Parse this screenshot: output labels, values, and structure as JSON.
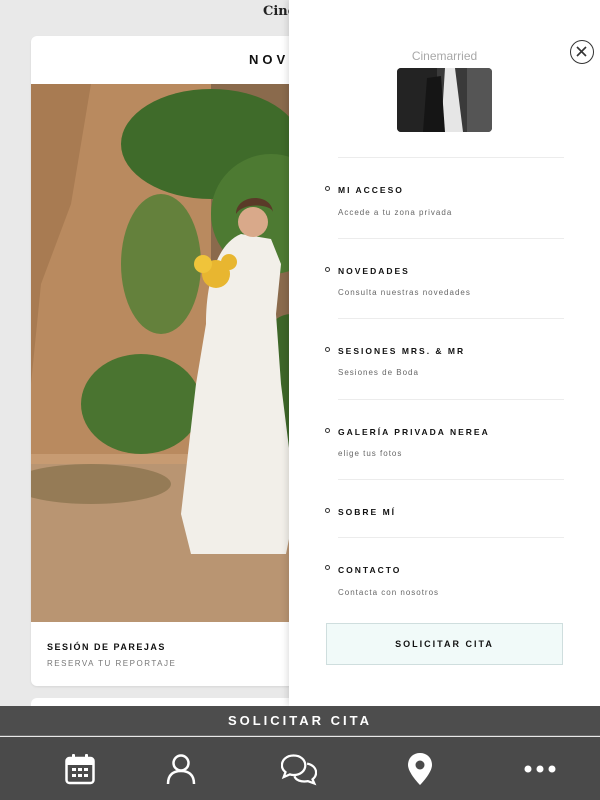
{
  "page": {
    "top_title": "Cine",
    "card_heading": "NOVEDADES",
    "card_caption_title": "SESIÓN DE PAREJAS",
    "card_caption_sub": "RESERVA TU REPORTAJE"
  },
  "drawer": {
    "logo_text": "Cinemarried",
    "menu": [
      {
        "label": "MI ACCESO",
        "desc": "Accede a tu zona privada"
      },
      {
        "label": "NOVEDADES",
        "desc": "Consulta nuestras novedades"
      },
      {
        "label": "SESIONES MRS. & MR",
        "desc": "Sesiones de Boda"
      },
      {
        "label": "GALERÍA PRIVADA NEREA",
        "desc": "elige tus fotos"
      },
      {
        "label": "SOBRE MÍ",
        "desc": ""
      },
      {
        "label": "CONTACTO",
        "desc": "Contacta con nosotros"
      }
    ],
    "cta_label": "SOLICITAR CITA"
  },
  "bottom": {
    "cta_label": "SOLICITAR CITA",
    "nav_icons": [
      "calendar-icon",
      "user-icon",
      "chat-icon",
      "location-pin-icon",
      "more-icon"
    ]
  },
  "colors": {
    "bottom_bar": "#4a4a4a",
    "drawer_cta_bg": "#f1faf9"
  }
}
